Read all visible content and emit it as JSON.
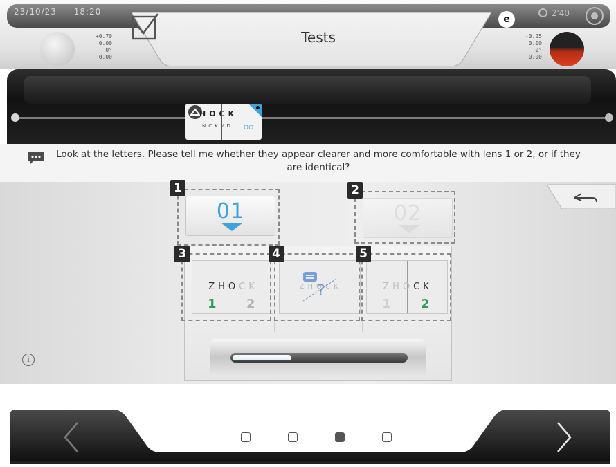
{
  "header": {
    "date": "23/10/23",
    "time": "18:20",
    "title": "Tests",
    "timer": "2'40",
    "left_rx": [
      "+0.70",
      "0.00",
      "0°",
      "0.00"
    ],
    "right_rx": [
      "-0.25",
      "0.00",
      "0°",
      "0.00"
    ]
  },
  "chart": {
    "line1": "HOCK",
    "line2": "NCKVD",
    "symbols": "OO"
  },
  "instruction": {
    "text": "Look at the letters. Please tell me whether they appear clearer and more comfortable with lens 1 or 2, or if they are identical?"
  },
  "highlights": [
    "1",
    "2",
    "3",
    "4",
    "5"
  ],
  "lens_buttons": {
    "lens1_label": "01",
    "lens2_label": "02"
  },
  "choices": {
    "lens1_better": {
      "letters_a": "ZHO",
      "letters_b": "CK",
      "num1": "1",
      "num2": "2"
    },
    "identical": {
      "letters": "ZHOCK"
    },
    "lens2_better": {
      "letters_a": "ZHO",
      "letters_b": "CK",
      "num1": "1",
      "num2": "2"
    }
  },
  "progress": {
    "fraction": 0.34
  },
  "pager": {
    "total": 4,
    "active_index": 2
  },
  "colors": {
    "accent_blue": "#3ea3d6",
    "green": "#2e9e55",
    "badge_dark": "#2a2a2a"
  }
}
